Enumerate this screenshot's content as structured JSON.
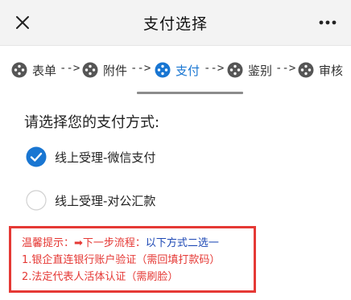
{
  "header": {
    "title": "支付选择",
    "close_icon": "close-icon",
    "more_icon": "more-icon"
  },
  "steps": [
    {
      "label": "表单",
      "active": false,
      "icon": "step-dots-icon"
    },
    {
      "label": "附件",
      "active": false,
      "icon": "step-dots-icon"
    },
    {
      "label": "支付",
      "active": true,
      "icon": "step-dots-icon"
    },
    {
      "label": "鉴别",
      "active": false,
      "icon": "step-dots-icon"
    },
    {
      "label": "审核",
      "active": false,
      "icon": "step-dots-icon"
    }
  ],
  "arrow": "-->",
  "content": {
    "prompt": "请选择您的支付方式:",
    "options": [
      {
        "label": "线上受理-微信支付",
        "selected": true
      },
      {
        "label": "线上受理-对公汇款",
        "selected": false
      }
    ]
  },
  "notice": {
    "prefix": "温馨提示：➡下一步流程：",
    "highlight": "以下方式二选一",
    "line2": "1.银企直连银行账户验证（需回填打款码）",
    "line3": "2.法定代表人活体认证（需刷脸）"
  },
  "colors": {
    "accent": "#1976d2",
    "warning": "#e53935",
    "highlight": "#1e49b5"
  }
}
